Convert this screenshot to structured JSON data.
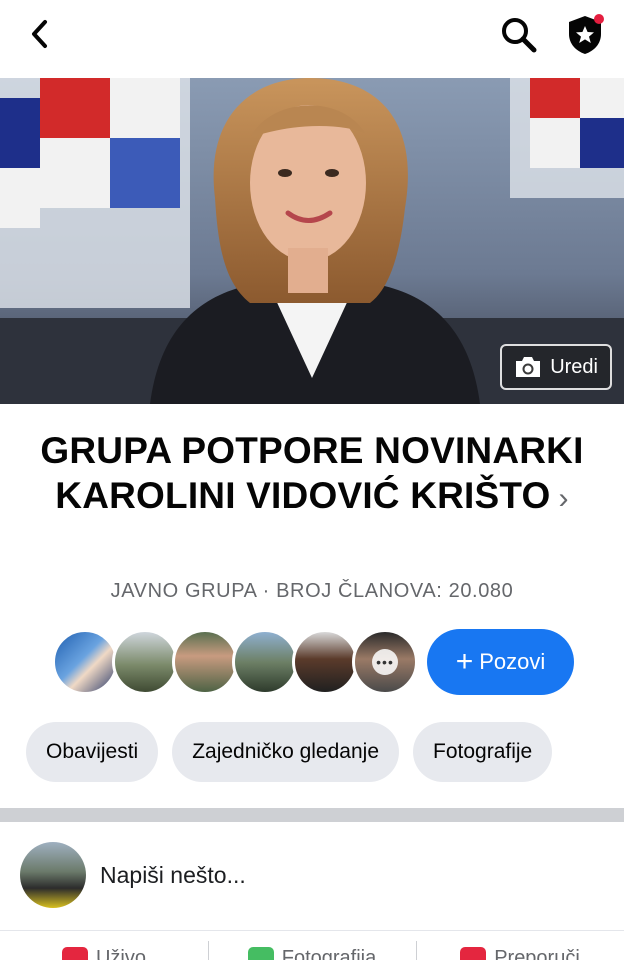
{
  "header": {
    "back_icon": "chevron-left-icon",
    "search_icon": "search-icon",
    "admin_icon": "shield-star-icon",
    "notification_color": "#e41e3f"
  },
  "cover": {
    "edit_label": "Uredi",
    "edit_icon": "camera-icon"
  },
  "group": {
    "title": "GRUPA POTPORE NOVINARKI KAROLINI VIDOVIĆ KRIŠTO",
    "title_chevron": "›",
    "meta": "JAVNO GRUPA · BROJ ČLANOVA: 20.080"
  },
  "members": {
    "avatars": [
      "member-1",
      "member-2",
      "member-3",
      "member-4",
      "member-5",
      "member-6"
    ],
    "more_label": "•••",
    "invite_label": "Pozovi",
    "invite_icon": "+",
    "accent": "#1877f2"
  },
  "tabs": [
    {
      "label": "Obavijesti"
    },
    {
      "label": "Zajedničko gledanje"
    },
    {
      "label": "Fotografije"
    }
  ],
  "composer": {
    "placeholder": "Napiši nešto..."
  },
  "actions": [
    {
      "label": "Uživo",
      "icon": "live-icon",
      "color": "#e4263f"
    },
    {
      "label": "Fotografija",
      "icon": "photo-icon",
      "color": "#45bd62"
    },
    {
      "label": "Preporuči",
      "icon": "recommend-icon",
      "color": "#e4263f"
    }
  ]
}
